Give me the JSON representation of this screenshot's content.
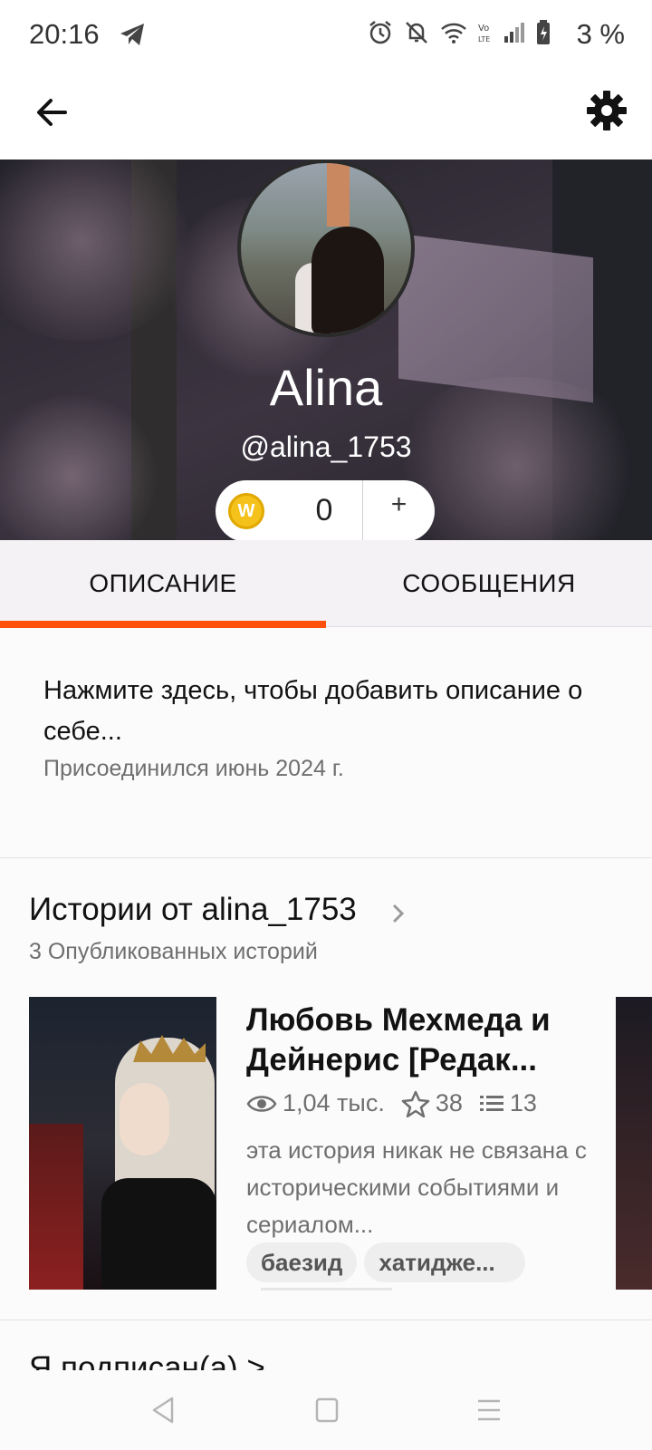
{
  "status_bar": {
    "time": "20:16",
    "battery": "3 %",
    "icons": [
      "telegram-icon",
      "alarm-icon",
      "bell-off-icon",
      "wifi-icon",
      "volte-icon",
      "signal-icon",
      "battery-icon"
    ]
  },
  "header": {
    "back_icon": "arrow-left-icon",
    "settings_icon": "gear-icon"
  },
  "profile": {
    "name": "Alina",
    "handle": "@alina_1753",
    "coins": "0",
    "coins_add": "+"
  },
  "tabs": [
    {
      "label": "ОПИСАНИЕ",
      "active": true
    },
    {
      "label": "СООБЩЕНИЯ",
      "active": false
    }
  ],
  "about": {
    "text": "Нажмите здесь, чтобы добавить описание о себе...",
    "joined": "Присоединился июнь 2024 г."
  },
  "stories": {
    "title": "Истории от alina_1753",
    "count": "3 Опубликованных историй",
    "items": [
      {
        "title": "Любовь Мехмеда и Дейнерис [Редак...",
        "reads": "1,04 тыс.",
        "votes": "38",
        "parts": "13",
        "description": "эта история никак не связана с историческими событиями и сериалом...",
        "tags": [
          "баезид",
          "хатидже..."
        ]
      }
    ]
  },
  "following": {
    "title": "Я подписан(а) >"
  },
  "colors": {
    "accent": "#ff500a",
    "text_primary": "#121212",
    "text_secondary": "#6f6f6f",
    "coin": "#f4c21a"
  }
}
